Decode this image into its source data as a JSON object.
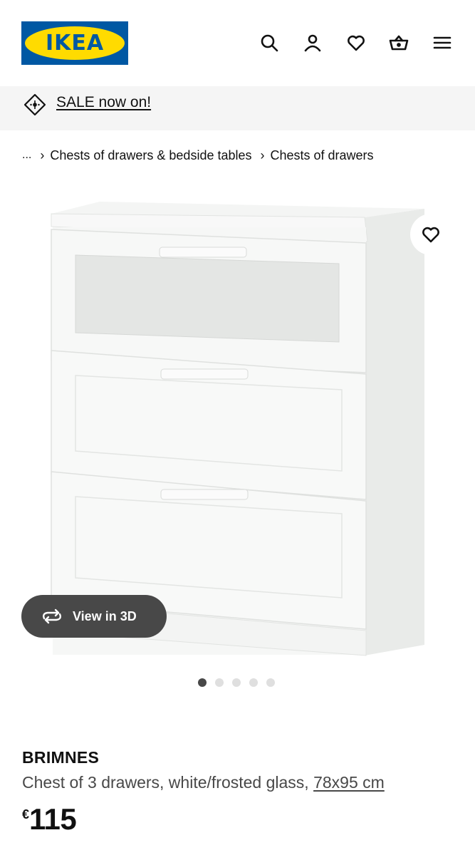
{
  "header": {
    "logo_text": "IKEA",
    "icons": [
      "search-icon",
      "user-icon",
      "heart-icon",
      "basket-icon",
      "menu-icon"
    ]
  },
  "sale_banner": {
    "label": "SALE now on!",
    "icon": "sale-tag-icon"
  },
  "breadcrumb": {
    "ellipsis": "...",
    "items": [
      "Chests of drawers & bedside tables",
      "Chests of drawers"
    ]
  },
  "gallery": {
    "view_3d_label": "View in 3D",
    "image_count": 5,
    "active_index": 0
  },
  "product": {
    "name": "BRIMNES",
    "description": "Chest of 3 drawers, white/frosted glass,",
    "dimensions": "78x95 cm",
    "currency": "€",
    "price": "115"
  },
  "colors": {
    "brand_blue": "#0058a3",
    "brand_yellow": "#ffdb00",
    "banner_bg": "#f5f5f5",
    "pill_bg": "#484848"
  }
}
